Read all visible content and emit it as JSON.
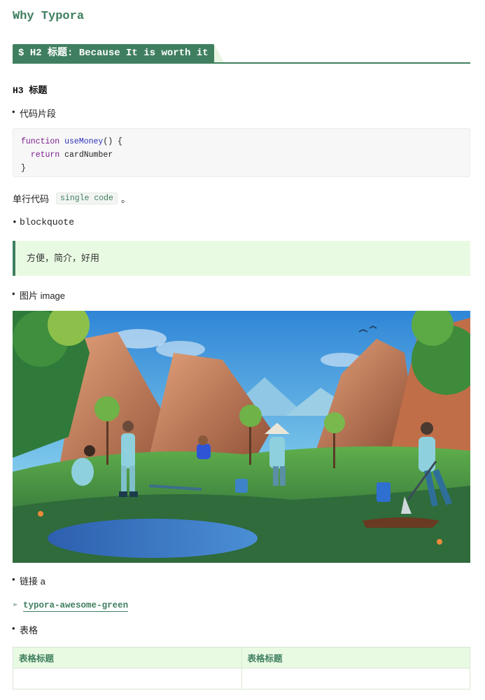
{
  "title": "Why Typora",
  "h2": {
    "prefix": "$",
    "text": "H2 标题: Because It is worth it"
  },
  "h3": "H3 标题",
  "bullets": {
    "code": "代码片段",
    "blockquote": "blockquote",
    "image": "图片 image",
    "link": "链接 a",
    "table": "表格"
  },
  "code_block": {
    "line1": {
      "kw": "function",
      "fn": "useMoney",
      "rest": "() {"
    },
    "line2": {
      "indent": "  ",
      "kw": "return",
      "rest": " cardNumber"
    },
    "line3": "}"
  },
  "inline": {
    "before": "单行代码",
    "code": "single code",
    "after": "。"
  },
  "quote": "方便，简介，好用",
  "image": {
    "icon": "illustration-tree-planting"
  },
  "link": {
    "arrow": "➢",
    "text": "typora-awesome-green"
  },
  "table": {
    "headers": [
      "表格标题",
      "表格标题"
    ],
    "rows": [
      [
        "",
        ""
      ]
    ]
  },
  "colors": {
    "accent": "#3f7f5f",
    "quote_bg": "#e9fae3",
    "code_bg": "#f7f7f7"
  }
}
